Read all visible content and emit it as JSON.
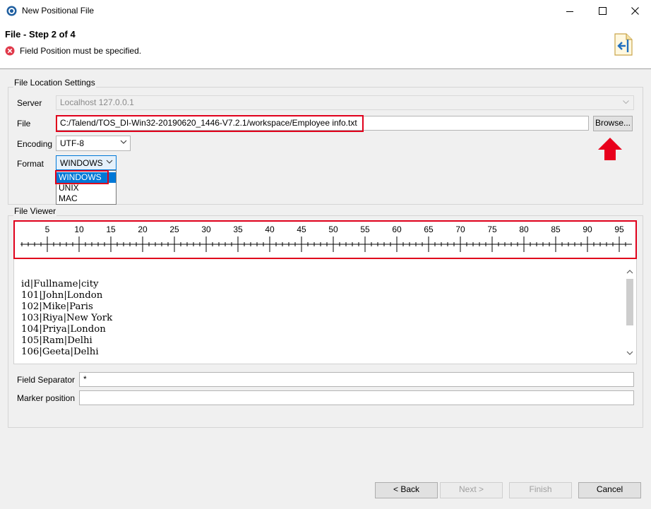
{
  "window": {
    "title": "New Positional File"
  },
  "header": {
    "step_title": "File - Step 2 of 4",
    "error_message": "Field Position must be specified."
  },
  "file_location": {
    "group_label": "File Location Settings",
    "server_label": "Server",
    "server_value": "Localhost 127.0.0.1",
    "file_label": "File",
    "file_value": "C:/Talend/TOS_DI-Win32-20190620_1446-V7.2.1/workspace/Employee info.txt",
    "browse_label": "Browse...",
    "encoding_label": "Encoding",
    "encoding_value": "UTF-8",
    "format_label": "Format",
    "format_value": "WINDOWS",
    "format_options": [
      "WINDOWS",
      "UNIX",
      "MAC"
    ]
  },
  "file_viewer": {
    "group_label": "File Viewer",
    "ruler_ticks": [
      "5",
      "10",
      "15",
      "20",
      "25",
      "30",
      "35",
      "40",
      "45",
      "50",
      "55",
      "60",
      "65",
      "70",
      "75",
      "80",
      "85",
      "90",
      "95"
    ],
    "lines": [
      "id|Fullname|city",
      "101|John|London",
      "102|Mike|Paris",
      "103|Riya|New York",
      "104|Priya|London",
      "105|Ram|Delhi",
      "106|Geeta|Delhi"
    ]
  },
  "fields": {
    "separator_label": "Field Separator",
    "separator_value": "*",
    "marker_label": "Marker position",
    "marker_value": ""
  },
  "buttons": {
    "back": "< Back",
    "next": "Next >",
    "finish": "Finish",
    "cancel": "Cancel"
  },
  "colors": {
    "highlight_red": "#e0001b",
    "selection_blue": "#0078d7",
    "error_red": "#e81123"
  }
}
